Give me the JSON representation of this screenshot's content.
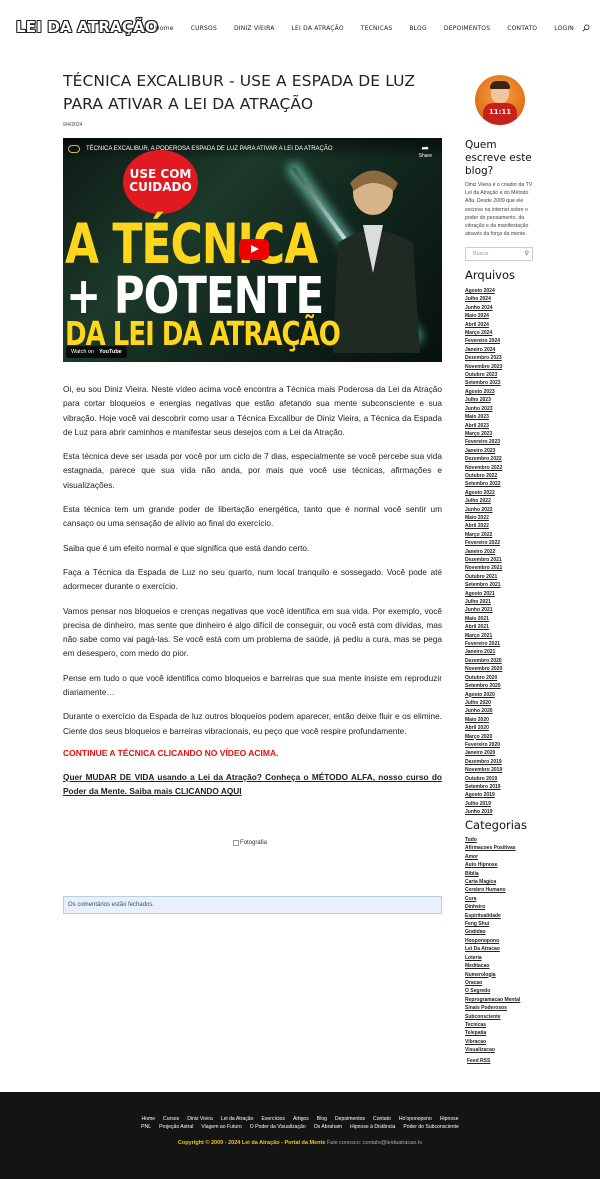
{
  "site": {
    "logo": "LEI DA ATRAÇÃO"
  },
  "nav": {
    "items": [
      "Home",
      "CURSOS",
      "DINIZ VIEIRA",
      "LEI DA ATRAÇÃO",
      "TECNICAS",
      "BLOG",
      "DEPOIMENTOS",
      "CONTATO",
      "LOGIN"
    ],
    "search_icon": "search-icon"
  },
  "post": {
    "title": "TÉCNICA EXCALIBUR - USE A ESPADA DE LUZ PARA ATIVAR A LEI DA ATRAÇÃO",
    "date": "9/4/2024"
  },
  "video": {
    "title": "TÉCNICA EXCALIBUR, A PODEROSA ESPADA DE LUZ PARA ATIVAR A LEI DA ATRAÇÃO",
    "share": "Share",
    "badge": "USE COM CUIDADO",
    "headline1": "A TÉCNICA",
    "headline2": "+ POTENTE",
    "headline3": "DA LEI DA ATRAÇÃO",
    "watch_on": "Watch on",
    "youtube": "YouTube"
  },
  "article": {
    "paragraphs": [
      "Oi, eu sou Diniz Vieira. Neste vídeo acima você encontra a Técnica mais Poderosa da Lei da Atração para cortar bloqueios e energias negativas que estão afetando sua mente subconsciente e sua vibração. Hoje você vai descobrir como usar a Técnica Excalibur de Diniz Vieira, a Técnica da Espada de Luz para abrir caminhos e manifestar seus desejos com a Lei da Atração.",
      "Esta técnica deve ser usada por você por um ciclo de 7 dias, especialmente se você percebe sua vida estagnada, parece que sua vida não anda, por mais que você use técnicas, afirmações e visualizações.",
      "Esta técnica tem um grande poder de libertação energética, tanto que é normal você sentir um cansaço ou uma sensação de alívio ao final do exercício.",
      "Saiba que é um efeito normal e que significa que está dando certo.",
      "Faça a Técnica da Espada de Luz no seu quarto, num local tranquilo e sossegado. Você pode até adormecer durante o exercício.",
      "Vamos pensar nos bloqueios e crenças negativas que você identifica em sua vida. Por exemplo, você precisa de dinheiro, mas sente que dinheiro é algo difícil de conseguir, ou você está com dívidas, mas não sabe como vai pagá-las. Se você está com um problema de saúde, já pediu a cura, mas se pega em desespero, com medo do pior.",
      "Pense em tudo o que você identifica como bloqueios e barreiras que sua mente insiste em reproduzir diariamente…",
      "Durante o exercício da Espada de luz outros bloqueios podem aparecer, então deixe fluir e os elimine. Ciente dos seus bloqueios e barreiras vibracionais, eu peço que você respire profundamente."
    ],
    "cta_red": "CONTINUE A TÉCNICA CLICANDO NO VÍDEO ACIMA.",
    "cta_link": "Quer MUDAR DE VIDA usando a Lei da Atração? Conheça o MÉTODO ALFA, nosso curso do Poder da Mente. Saiba mais CLICANDO AQUI",
    "image_alt": "Fotografia",
    "comments_closed": "Os comentários estão fechados."
  },
  "sidebar": {
    "avatar_text": "11:11",
    "who_title": "Quem escreve este blog?",
    "who_text": "Diniz Vieira é o criador da TV Lei da Atração e do Método Alfa. Desde 2009 que ele escreve na internet sobre o poder do pensamento, da vibração e da manifestação através da força da mente.",
    "search_placeholder": "Busca",
    "archives_title": "Arquivos",
    "archives": [
      "Agosto 2024",
      "Julho 2024",
      "Junho 2024",
      "Maio 2024",
      "Abril 2024",
      "Março 2024",
      "Fevereiro 2024",
      "Janeiro 2024",
      "Dezembro 2023",
      "Novembro 2023",
      "Outubro 2023",
      "Setembro 2023",
      "Agosto 2023",
      "Julho 2023",
      "Junho 2023",
      "Maio 2023",
      "Abril 2023",
      "Março 2023",
      "Fevereiro 2023",
      "Janeiro 2023",
      "Dezembro 2022",
      "Novembro 2022",
      "Outubro 2022",
      "Setembro 2022",
      "Agosto 2022",
      "Julho 2022",
      "Junho 2022",
      "Maio 2022",
      "Abril 2022",
      "Março 2022",
      "Fevereiro 2022",
      "Janeiro 2022",
      "Dezembro 2021",
      "Novembro 2021",
      "Outubro 2021",
      "Setembro 2021",
      "Agosto 2021",
      "Julho 2021",
      "Junho 2021",
      "Maio 2021",
      "Abril 2021",
      "Março 2021",
      "Fevereiro 2021",
      "Janeiro 2021",
      "Dezembro 2020",
      "Novembro 2020",
      "Outubro 2020",
      "Setembro 2020",
      "Agosto 2020",
      "Julho 2020",
      "Junho 2020",
      "Maio 2020",
      "Abril 2020",
      "Março 2020",
      "Fevereiro 2020",
      "Janeiro 2020",
      "Dezembro 2019",
      "Novembro 2019",
      "Outubro 2019",
      "Setembro 2019",
      "Agosto 2019",
      "Julho 2019",
      "Junho 2019"
    ],
    "categories_title": "Categorias",
    "categories": [
      "Tudo",
      "Afirmacoes Positivas",
      "Amor",
      "Auto Hipnose",
      "Bíblia",
      "Carta Magica",
      "Cerebro Humano",
      "Cura",
      "Dinheiro",
      "Espiritualidade",
      "Feng Shui",
      "Gratidao",
      "Hooponopono",
      "Lei Da Atracao",
      "Loteria",
      "Meditacao",
      "Numerologia",
      "Oracao",
      "O Segredo",
      "Reprogramacao Mental",
      "Sinais Poderosos",
      "Subconsciente",
      "Tecnicas",
      "Telepatia",
      "Vibracao",
      "Visualizacao"
    ],
    "feed": "Feed RSS"
  },
  "footer": {
    "row1": [
      "Home",
      "Cursos",
      "Diniz Vieira",
      "Lei da Atração",
      "Exercícios",
      "Artigos",
      "Blog",
      "Depoimentos",
      "Contato",
      "Ho'oponopono",
      "Hipnose"
    ],
    "row2": [
      "PNL",
      "Projeção Astral",
      "Viagem ao Futuro",
      "O Poder da Visualização",
      "Os Abraham",
      "Hipnose à Distância",
      "Poder do Subconsciente"
    ],
    "copyright": "Copyright © 2009 - 2024 Lei da Atração - Portal da Mente",
    "contact": "Fale conosco: contato@leidaatracao.tv"
  }
}
